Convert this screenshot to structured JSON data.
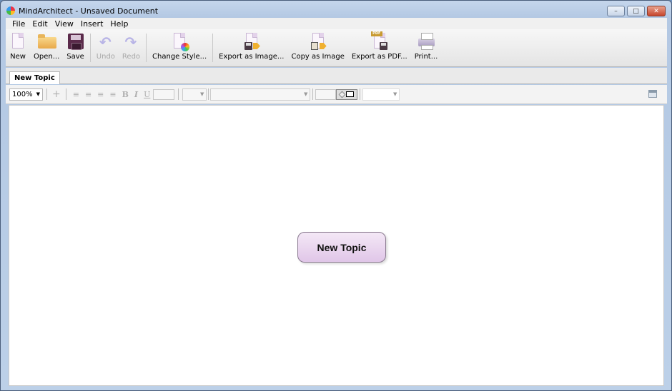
{
  "window": {
    "title": "MindArchitect - Unsaved Document",
    "controls": {
      "minimize": "–",
      "maximize": "□",
      "close": "✕"
    }
  },
  "menu": [
    "File",
    "Edit",
    "View",
    "Insert",
    "Help"
  ],
  "toolbar": {
    "new": "New",
    "open": "Open...",
    "save": "Save",
    "undo": "Undo",
    "redo": "Redo",
    "change_style": "Change Style...",
    "export_image": "Export as Image...",
    "copy_image": "Copy as Image",
    "export_pdf": "Export as PDF...",
    "print": "Print...",
    "pdf_tag": "PDF",
    "undo_glyph": "↶",
    "redo_glyph": "↷"
  },
  "tabs": [
    {
      "label": "New Topic",
      "active": true
    }
  ],
  "format_bar": {
    "zoom": "100%",
    "add_glyph": "+",
    "align_left": "≡",
    "align_center": "≡",
    "align_right": "≡",
    "justify": "≡",
    "bold": "B",
    "italic": "I",
    "underline": "U",
    "font_size": "",
    "font_name": "",
    "line_style": "",
    "disabled": true
  },
  "canvas": {
    "topics": [
      {
        "label": "New Topic",
        "fill_top": "#f4e8f6",
        "fill_bottom": "#e0c6e8"
      }
    ]
  }
}
